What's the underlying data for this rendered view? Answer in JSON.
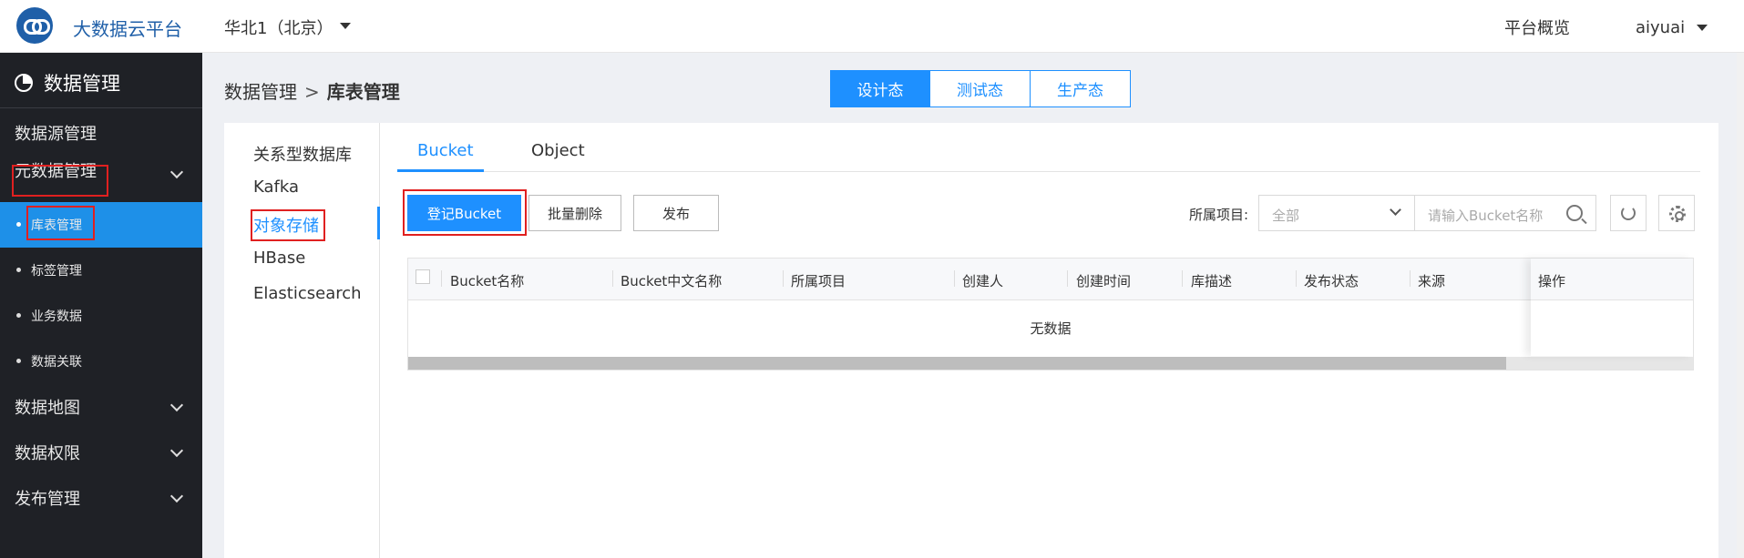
{
  "header": {
    "brand": "大数据云平台",
    "region": "华北1（北京）",
    "overview": "平台概览",
    "user": "aiyuai"
  },
  "sidebar": {
    "title": "数据管理",
    "items": [
      {
        "label": "数据源管理"
      },
      {
        "label": "元数据管理"
      },
      {
        "label": "数据地图"
      },
      {
        "label": "数据权限"
      },
      {
        "label": "发布管理"
      }
    ],
    "subitems": [
      {
        "label": "库表管理",
        "active": true
      },
      {
        "label": "标签管理"
      },
      {
        "label": "业务数据"
      },
      {
        "label": "数据关联"
      }
    ]
  },
  "breadcrumb": {
    "parent": "数据管理",
    "separator": ">",
    "current": "库表管理"
  },
  "env_tabs": [
    {
      "label": "设计态",
      "active": true
    },
    {
      "label": "测试态"
    },
    {
      "label": "生产态"
    }
  ],
  "left_nav": [
    {
      "label": "关系型数据库"
    },
    {
      "label": "Kafka"
    },
    {
      "label": "对象存储",
      "active": true
    },
    {
      "label": "HBase"
    },
    {
      "label": "Elasticsearch"
    }
  ],
  "content_tabs": [
    {
      "label": "Bucket",
      "active": true
    },
    {
      "label": "Object"
    }
  ],
  "toolbar": {
    "register_label": "登记Bucket",
    "batch_delete_label": "批量删除",
    "publish_label": "发布",
    "project_label": "所属项目:",
    "project_value": "全部",
    "search_placeholder": "请输入Bucket名称"
  },
  "table": {
    "columns": [
      "Bucket名称",
      "Bucket中文名称",
      "所属项目",
      "创建人",
      "创建时间",
      "库描述",
      "发布状态",
      "来源",
      "操作"
    ],
    "empty_text": "无数据"
  },
  "colors": {
    "accent": "#1e90ff",
    "sidebar_bg": "#1f2126",
    "highlight": "#e02020"
  }
}
